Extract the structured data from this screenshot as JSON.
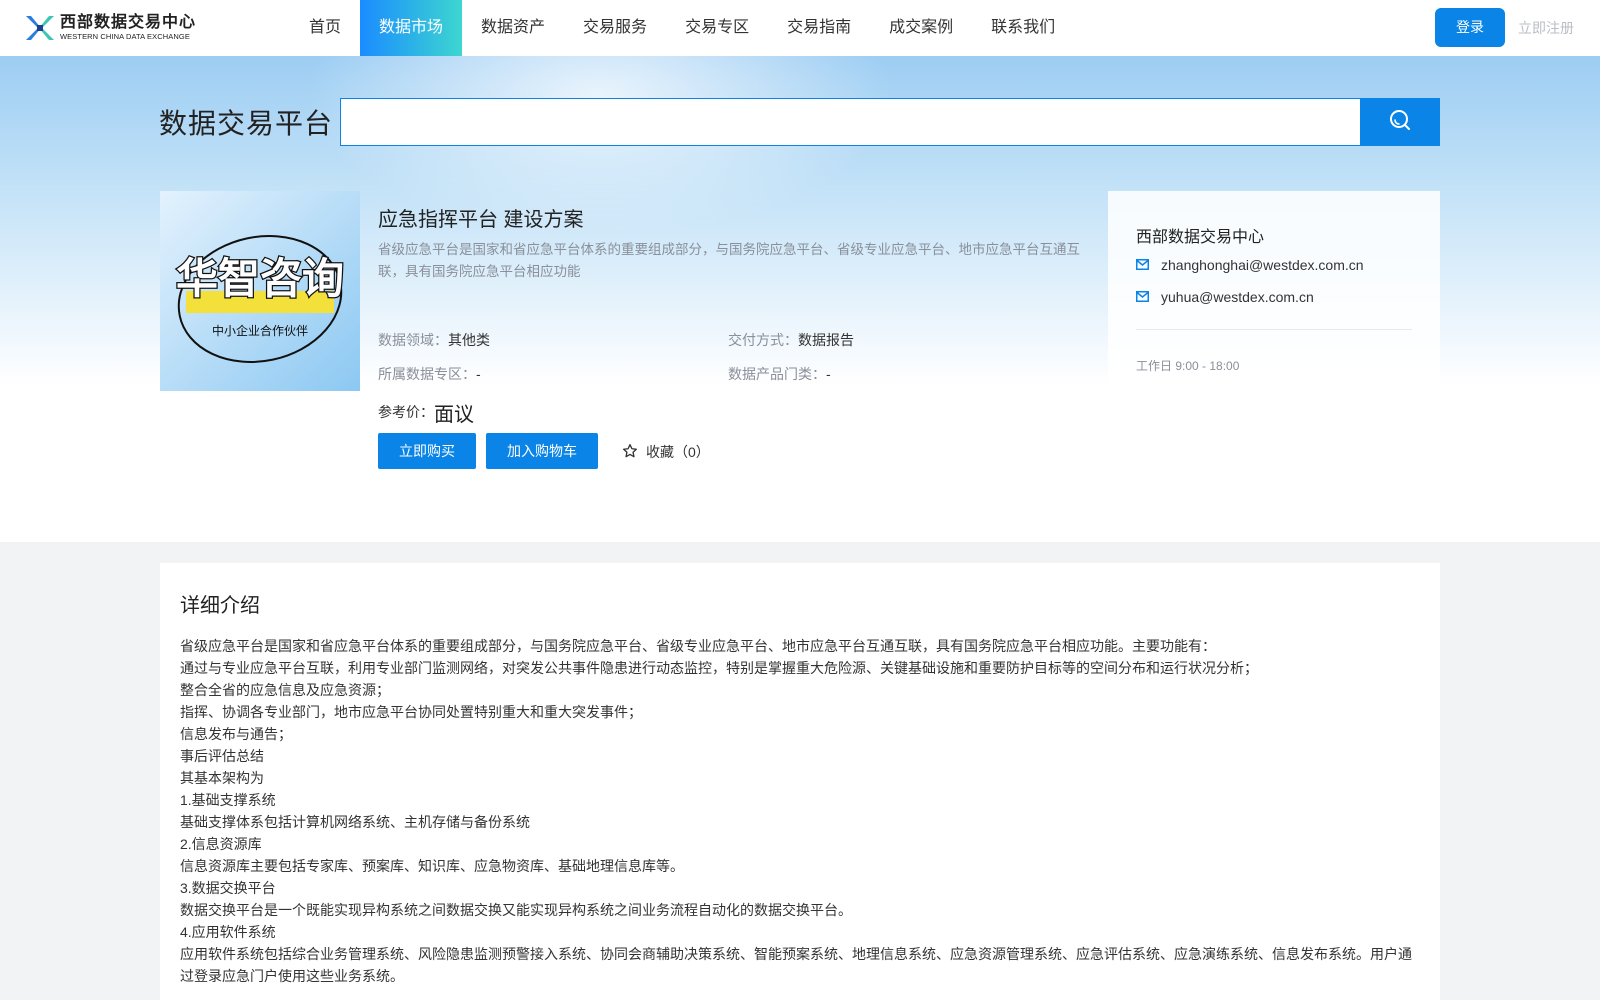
{
  "logo": {
    "cn": "西部数据交易中心",
    "en": "WESTERN CHINA DATA EXCHANGE"
  },
  "nav": [
    {
      "label": "首页",
      "active": false
    },
    {
      "label": "数据市场",
      "active": true
    },
    {
      "label": "数据资产",
      "active": false
    },
    {
      "label": "交易服务",
      "active": false
    },
    {
      "label": "交易专区",
      "active": false
    },
    {
      "label": "交易指南",
      "active": false
    },
    {
      "label": "成交案例",
      "active": false
    },
    {
      "label": "联系我们",
      "active": false
    }
  ],
  "auth": {
    "login": "登录",
    "register": "立即注册"
  },
  "hero": {
    "title": "数据交易平台",
    "search_value": ""
  },
  "product": {
    "image_text_main": "华智咨询",
    "image_text_sub": "中小企业合作伙伴",
    "title": "应急指挥平台 建设方案",
    "desc": "省级应急平台是国家和省应急平台体系的重要组成部分，与国务院应急平台、省级专业应急平台、地市应急平台互通互联，具有国务院应急平台相应功能",
    "attrs": {
      "domain_k": "数据领域：",
      "domain_v": "其他类",
      "delivery_k": "交付方式：",
      "delivery_v": "数据报告",
      "zone_k": "所属数据专区：",
      "zone_v": "-",
      "category_k": "数据产品门类：",
      "category_v": "-"
    },
    "price_label": "参考价：",
    "price_value": "面议",
    "buy": "立即购买",
    "cart": "加入购物车",
    "fav": "收藏（0）"
  },
  "contact": {
    "name": "西部数据交易中心",
    "email1": "zhanghonghai@westdex.com.cn",
    "email2": "yuhua@westdex.com.cn",
    "hours": "工作日 9:00 - 18:00"
  },
  "details": {
    "title": "详细介绍",
    "lines": [
      "省级应急平台是国家和省应急平台体系的重要组成部分，与国务院应急平台、省级专业应急平台、地市应急平台互通互联，具有国务院应急平台相应功能。主要功能有：",
      "通过与专业应急平台互联，利用专业部门监测网络，对突发公共事件隐患进行动态监控，特别是掌握重大危险源、关键基础设施和重要防护目标等的空间分布和运行状况分析；",
      "整合全省的应急信息及应急资源；",
      "指挥、协调各专业部门，地市应急平台协同处置特别重大和重大突发事件；",
      "信息发布与通告；",
      "事后评估总结",
      "其基本架构为",
      "1.基础支撑系统",
      "基础支撑体系包括计算机网络系统、主机存储与备份系统",
      "2.信息资源库",
      "信息资源库主要包括专家库、预案库、知识库、应急物资库、基础地理信息库等。",
      "3.数据交换平台",
      "数据交换平台是一个既能实现异构系统之间数据交换又能实现异构系统之间业务流程自动化的数据交换平台。",
      "4.应用软件系统",
      "应用软件系统包括综合业务管理系统、风险隐患监测预警接入系统、协同会商辅助决策系统、智能预案系统、地理信息系统、应急资源管理系统、应急评估系统、应急演练系统、信息发布系统。用户通过登录应急门户使用这些业务系统。"
    ]
  }
}
